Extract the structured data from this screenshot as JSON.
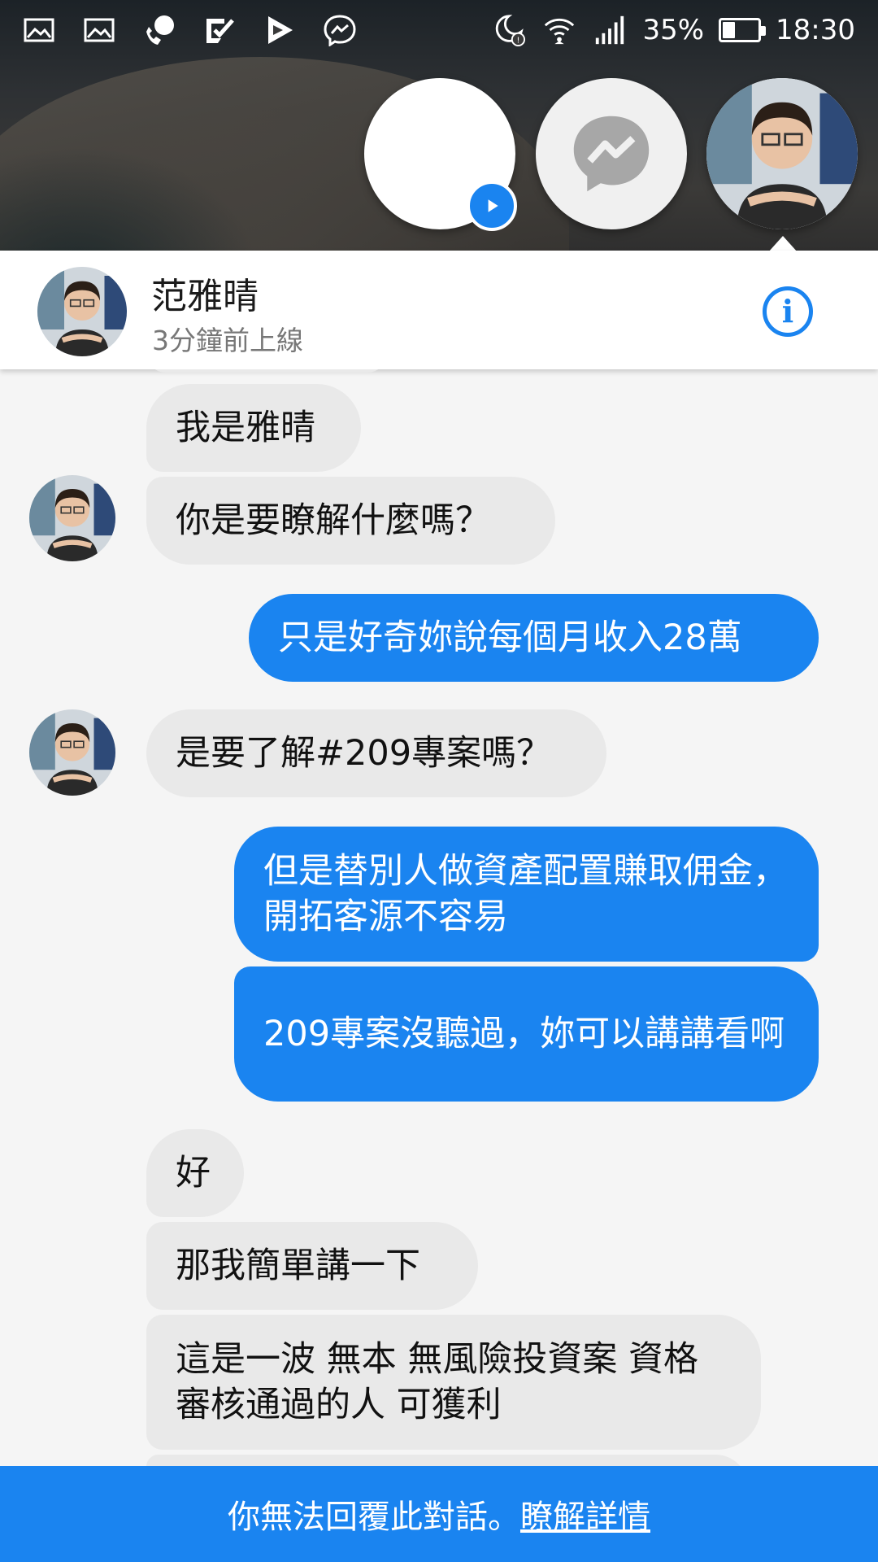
{
  "status_bar": {
    "battery": "35%",
    "time": "18:30",
    "battery_level": 0.35,
    "icons": [
      "gallery-icon",
      "gallery-icon",
      "phone-icon",
      "checklist-icon",
      "play-store-icon",
      "messenger-icon",
      "do-not-disturb-icon",
      "wifi-icon",
      "signal-icon"
    ]
  },
  "chat_heads": [
    "video-chat-head",
    "messenger-chat-head",
    "contact-chat-head"
  ],
  "header": {
    "name": "范雅晴",
    "status": "3分鐘前上線",
    "info_icon": "info-icon"
  },
  "messages": [
    {
      "sender": "them",
      "text": "我是雅晴"
    },
    {
      "sender": "them",
      "text": "你是要瞭解什麼嗎？"
    },
    {
      "sender": "me",
      "text": "只是好奇妳說每個月收入28萬"
    },
    {
      "sender": "them",
      "text": "是要了解#209專案嗎？"
    },
    {
      "sender": "me",
      "text": "但是替別人做資產配置賺取佣金，開拓客源不容易"
    },
    {
      "sender": "me",
      "text": "209專案沒聽過，妳可以講講看啊"
    },
    {
      "sender": "them",
      "text": "好"
    },
    {
      "sender": "them",
      "text": "那我簡單講一下"
    },
    {
      "sender": "them",
      "text": "這是一波 無本 無風險投資案 資格審核通過的人 可獲利"
    }
  ],
  "bottom_bar": {
    "notice": "你無法回覆此對話。",
    "link": "瞭解詳情"
  },
  "colors": {
    "accent": "#1a84f0",
    "received_bubble": "#e9e9e9",
    "background": "#f5f5f5"
  }
}
